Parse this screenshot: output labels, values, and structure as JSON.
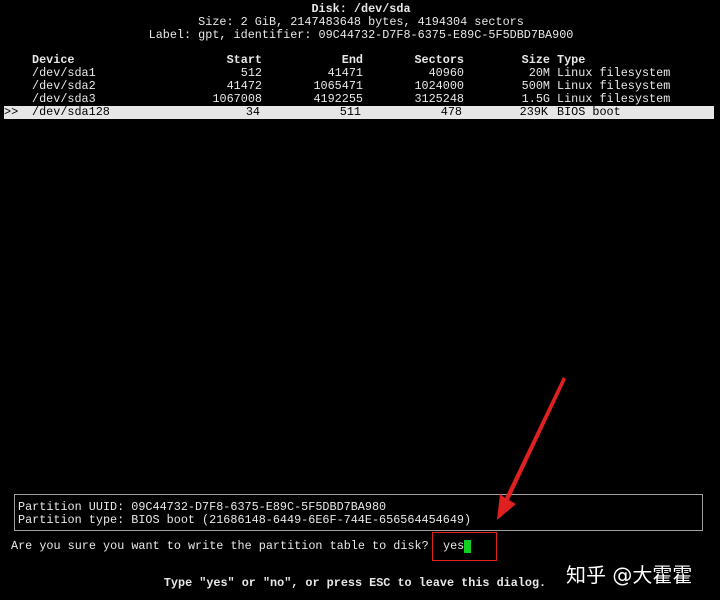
{
  "header": {
    "title": "Disk: /dev/sda",
    "size_line": "Size: 2 GiB, 2147483648 bytes, 4194304 sectors",
    "label_line": "Label: gpt, identifier: 09C44732-D7F8-6375-E89C-5F5DBD7BA900"
  },
  "table": {
    "columns": [
      "Device",
      "Start",
      "End",
      "Sectors",
      "Size",
      "Type"
    ],
    "rows": [
      {
        "device": "/dev/sda1",
        "start": "512",
        "end": "41471",
        "sectors": "40960",
        "size": "20M",
        "type": "Linux filesystem",
        "selected": false
      },
      {
        "device": "/dev/sda2",
        "start": "41472",
        "end": "1065471",
        "sectors": "1024000",
        "size": "500M",
        "type": "Linux filesystem",
        "selected": false
      },
      {
        "device": "/dev/sda3",
        "start": "1067008",
        "end": "4192255",
        "sectors": "3125248",
        "size": "1.5G",
        "type": "Linux filesystem",
        "selected": false
      },
      {
        "device": "/dev/sda128",
        "start": "34",
        "end": "511",
        "sectors": "478",
        "size": "239K",
        "type": "BIOS boot",
        "selected": true,
        "marker": ">>"
      }
    ]
  },
  "info": {
    "uuid_line": "Partition UUID: 09C44732-D7F8-6375-E89C-5F5DBD7BA980",
    "type_line": "Partition type: BIOS boot (21686148-6449-6E6F-744E-656564454649)"
  },
  "prompt": {
    "question": "Are you sure you want to write the partition table to disk?",
    "answer": "yes",
    "hint": "Type \"yes\" or \"no\", or press ESC to leave this dialog."
  },
  "watermark": "知乎 @大霍霍",
  "colors": {
    "background": "#000000",
    "selection": "#e6e6e6",
    "cursor": "#10d020",
    "annotation": "#e02020"
  }
}
